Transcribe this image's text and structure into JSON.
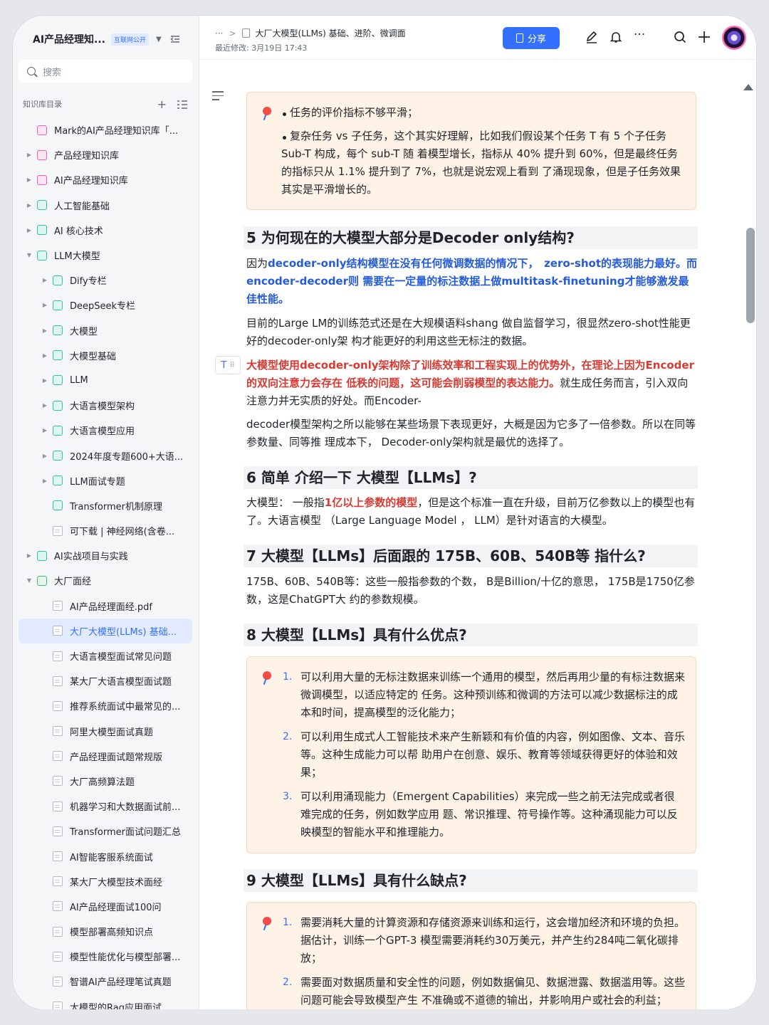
{
  "sidebar": {
    "title": "AI产品经理知...",
    "badge": "互联网公开",
    "search_placeholder": "搜索",
    "section_label": "知识库目录",
    "items": [
      {
        "label": "Mark的AI产品经理知识库「...",
        "icon": "pink",
        "level": 0,
        "arrow": false
      },
      {
        "label": "产品经理知识库",
        "icon": "pink",
        "level": 0,
        "arrow": true
      },
      {
        "label": "AI产品经理知识库",
        "icon": "pink",
        "level": 0,
        "arrow": true
      },
      {
        "label": "人工智能基础",
        "icon": "teal",
        "level": 0,
        "arrow": true
      },
      {
        "label": "AI 核心技术",
        "icon": "teal",
        "level": 0,
        "arrow": true
      },
      {
        "label": "LLM大模型",
        "icon": "teal",
        "level": 0,
        "arrow": true,
        "open": true
      },
      {
        "label": "Dify专栏",
        "icon": "teal",
        "level": 1,
        "arrow": true
      },
      {
        "label": "DeepSeek专栏",
        "icon": "teal",
        "level": 1,
        "arrow": true
      },
      {
        "label": "大模型",
        "icon": "teal",
        "level": 1,
        "arrow": true
      },
      {
        "label": "大模型基础",
        "icon": "teal",
        "level": 1,
        "arrow": true
      },
      {
        "label": "LLM",
        "icon": "teal",
        "level": 1,
        "arrow": true
      },
      {
        "label": "大语言模型架构",
        "icon": "teal",
        "level": 1,
        "arrow": true
      },
      {
        "label": "大语言模型应用",
        "icon": "teal",
        "level": 1,
        "arrow": true
      },
      {
        "label": "2024年度专题600+大语...",
        "icon": "teal",
        "level": 1,
        "arrow": true
      },
      {
        "label": "LLM面试专题",
        "icon": "teal",
        "level": 1,
        "arrow": true
      },
      {
        "label": "Transformer机制原理",
        "icon": "teal",
        "level": 1,
        "arrow": false
      },
      {
        "label": "可下载 | 神经网络(含卷...",
        "icon": "doc",
        "level": 1,
        "arrow": false
      },
      {
        "label": "AI实战项目与实践",
        "icon": "teal",
        "level": 0,
        "arrow": true
      },
      {
        "label": "大厂面经",
        "icon": "folder",
        "level": 0,
        "arrow": true,
        "open": true
      },
      {
        "label": "AI产品经理面经.pdf",
        "icon": "doc",
        "level": 1,
        "arrow": false
      },
      {
        "label": "大厂大模型(LLMs) 基础...",
        "icon": "doc",
        "level": 1,
        "arrow": false,
        "active": true
      },
      {
        "label": "大语言模型面试常见问题",
        "icon": "doc",
        "level": 1,
        "arrow": false
      },
      {
        "label": "某大厂大语言模型面试题",
        "icon": "doc",
        "level": 1,
        "arrow": false
      },
      {
        "label": "推荐系统面试中最常见的...",
        "icon": "doc",
        "level": 1,
        "arrow": false
      },
      {
        "label": "阿里大模型面试真题",
        "icon": "doc",
        "level": 1,
        "arrow": false
      },
      {
        "label": "产品经理面试题常规版",
        "icon": "doc",
        "level": 1,
        "arrow": false
      },
      {
        "label": "大厂高频算法题",
        "icon": "doc",
        "level": 1,
        "arrow": false
      },
      {
        "label": "机器学习和大数据面试前...",
        "icon": "doc",
        "level": 1,
        "arrow": false
      },
      {
        "label": "Transformer面试问题汇总",
        "icon": "doc",
        "level": 1,
        "arrow": false
      },
      {
        "label": "AI智能客服系统面试",
        "icon": "doc",
        "level": 1,
        "arrow": false
      },
      {
        "label": "某大厂大模型技术面经",
        "icon": "doc",
        "level": 1,
        "arrow": false
      },
      {
        "label": "AI产品经理面试100问",
        "icon": "doc",
        "level": 1,
        "arrow": false
      },
      {
        "label": "模型部署高频知识点",
        "icon": "doc",
        "level": 1,
        "arrow": false
      },
      {
        "label": "模型性能优化与模型部署...",
        "icon": "doc",
        "level": 1,
        "arrow": false
      },
      {
        "label": "智谱AI产品经理笔试真题",
        "icon": "doc",
        "level": 1,
        "arrow": false
      },
      {
        "label": "大模型的Rag应用面试",
        "icon": "doc",
        "level": 1,
        "arrow": false
      }
    ]
  },
  "topbar": {
    "ellipsis": "···",
    "separator": ">",
    "doc_title": "大厂大模型(LLMs) 基础、进阶、微调面",
    "modified": "最近修改: 3月19日 17:43",
    "share_label": "分享"
  },
  "doc": {
    "callout1": {
      "b1": "任务的评价指标不够平滑；",
      "b2": "复杂任务 vs 子任务，这个其实好理解，比如我们假设某个任务 T 有 5 个子任务 Sub-T 构成，每个 sub-T 随 着模型增长，指标从 40% 提升到 60%，但是最终任务的指标只从 1.1% 提升到了 7%，也就是说宏观上看到 了涌现现象，但是子任务效果其实是平滑增长的。"
    },
    "h5": "5 为何现在的大模型大部分是Decoder only结构?",
    "p5a": {
      "t1": "因为",
      "b1": "decoder-only结构模型在没有任何微调数据的情况下，",
      "t2": "　",
      "b2": "zero-shot的表现能力最好。而encoder-decoder则 需要在一定量的标注数据上做multitask-finetuning才能够激发最佳性能。"
    },
    "p5b": "目前的Large LM的训练范式还是在大规模语料shang 做自监督学习，很显然zero-shot性能更好的decoder-only架 构才能更好的利用这些无标注的数据。",
    "p5c": {
      "r1": "大模型使用decoder-only架构除了训练效率和工程实现上的优势外，在理论上因为Encoder的双向注意力会存在 低秩的问题，这可能会削弱模型的表达能力。",
      "t1": "就生成任务而言，引入双向注意力并无实质的好处。而Encoder-"
    },
    "p5d": "decoder模型架构之所以能够在某些场景下表现更好，大概是因为它多了一倍参数。所以在同等参数量、同等推 理成本下， Decoder-only架构就是最优的选择了。",
    "h6": "6 简单 介绍一下 大模型【LLMs】?",
    "p6": {
      "t1": "大模型： 一般指",
      "r1": "1亿以上参数的模型",
      "t2": "，但是这个标准一直在升级，目前万亿参数以上的模型也有了。大语言模型 （Large Language Model ， LLM）是针对语言的大模型。"
    },
    "h7": "7 大模型【LLMs】后面跟的 175B、60B、540B等 指什么?",
    "p7": "175B、60B、540B等：这些一般指参数的个数， B是Billion/十亿的意思， 175B是1750亿参数，这是ChatGPT大 约的参数规模。",
    "h8": "8 大模型【LLMs】具有什么优点?",
    "list8": [
      {
        "n": "1.",
        "text": "可以利用大量的无标注数据来训练一个通用的模型，然后再用少量的有标注数据来微调模型，以适应特定的 任务。这种预训练和微调的方法可以减少数据标注的成本和时间，提高模型的泛化能力；"
      },
      {
        "n": "2.",
        "text": "可以利用生成式人工智能技术来产生新颖和有价值的内容，例如图像、文本、音乐等。这种生成能力可以帮 助用户在创意、娱乐、教育等领域获得更好的体验和效果；"
      },
      {
        "n": "3.",
        "text": "可以利用涌现能力（Emergent Capabilities）来完成一些之前无法完成或者很难完成的任务，例如数学应用 题、常识推理、符号操作等。这种涌现能力可以反映模型的智能水平和推理能力。"
      }
    ],
    "h9": "9 大模型【LLMs】具有什么缺点?",
    "list9": [
      {
        "n": "1.",
        "text": "需要消耗大量的计算资源和存储资源来训练和运行，这会增加经济和环境的负担。据估计，训练一个GPT-3 模型需要消耗约30万美元，并产生约284吨二氧化碳排放；"
      },
      {
        "n": "2.",
        "text": "需要面对数据质量和安全性的问题，例如数据偏见、数据泄露、数据滥用等。这些问题可能会导致模型产生 不准确或不道德的输出，并影响用户或社会的利益；"
      }
    ]
  },
  "icons": [
    "search-icon",
    "add-icon",
    "list-icon",
    "pen-icon",
    "bell-icon",
    "more-icon",
    "plus-icon",
    "outline-icon"
  ]
}
